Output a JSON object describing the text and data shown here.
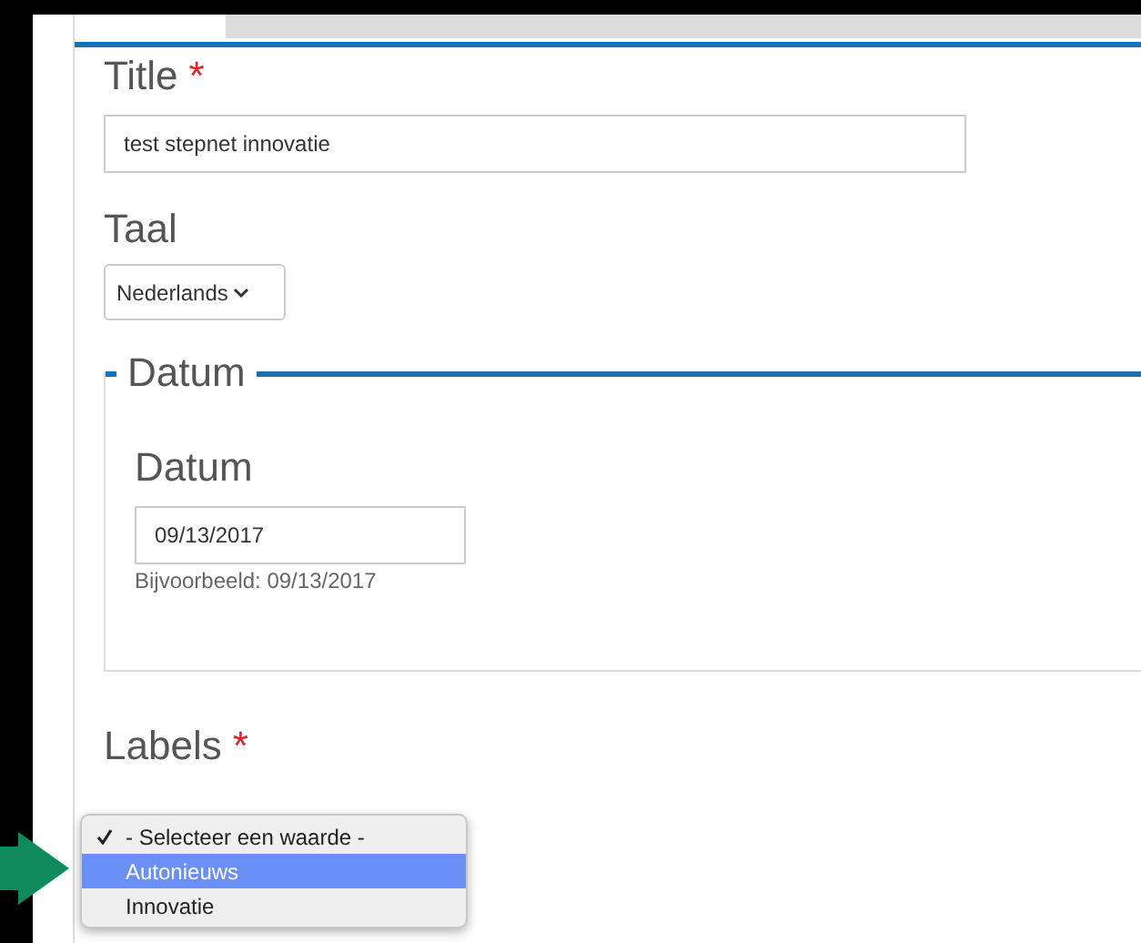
{
  "title_field": {
    "label": "Title",
    "required_mark": "*",
    "value": "test stepnet innovatie"
  },
  "language_field": {
    "label": "Taal",
    "value": "Nederlands"
  },
  "date_group": {
    "legend": "Datum",
    "label": "Datum",
    "value": "09/13/2017",
    "hint": "Bijvoorbeeld: 09/13/2017"
  },
  "labels_field": {
    "label": "Labels",
    "required_mark": "*",
    "options": [
      {
        "text": "- Selecteer een waarde -",
        "checked": true,
        "selected": false
      },
      {
        "text": "Autonieuws",
        "checked": false,
        "selected": true
      },
      {
        "text": "Innovatie",
        "checked": false,
        "selected": false
      }
    ]
  }
}
